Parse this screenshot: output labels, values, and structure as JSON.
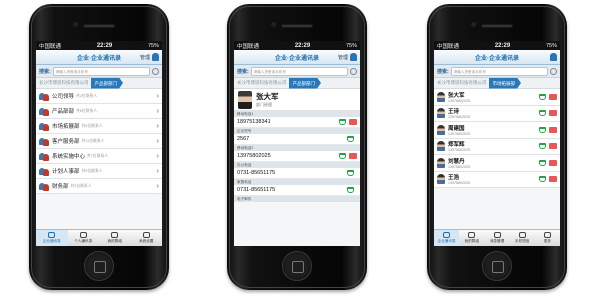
{
  "status": {
    "carrier": "中国联通",
    "time": "22:29",
    "battery": "75%"
  },
  "colors": {
    "accent": "#1b6fb0",
    "call": "#27a04a",
    "sms": "#e85656"
  },
  "app": {
    "title": "企业·企业通讯录",
    "user": "管理"
  },
  "search": {
    "label": "搜索:",
    "placeholder": "请输入拼音或手机号"
  },
  "screen1": {
    "crumbs": [
      "长沙市博思科技有限公司",
      "产品部部门"
    ],
    "departments": [
      {
        "name": "公司领导",
        "count": "共2位联系人",
        "icon": "group-icon"
      },
      {
        "name": "产品部部",
        "count": "共6位联系人",
        "icon": "group-icon"
      },
      {
        "name": "市场拓展部",
        "count": "共6位联系人",
        "icon": "group-icon"
      },
      {
        "name": "客户服务部",
        "count": "共11位联系人",
        "icon": "group-icon"
      },
      {
        "name": "系统实施中心",
        "count": "共7位联系人",
        "icon": "group-icon"
      },
      {
        "name": "计划人事部",
        "count": "共6位联系人",
        "icon": "group-icon"
      },
      {
        "name": "财务部",
        "count": "共3位联系人",
        "icon": "group-icon"
      }
    ]
  },
  "screen2": {
    "crumbs": [
      "长沙市博思科技有限公司",
      "产品部部门"
    ],
    "contact": {
      "name": "张大军",
      "dept": "部门经理"
    },
    "fields": [
      {
        "label": "移动电话1",
        "value": "18975138341",
        "call": true,
        "sms": true
      },
      {
        "label": "企业短号",
        "value": "2567",
        "call": true,
        "sms": false
      },
      {
        "label": "移动电话2",
        "value": "13975802025",
        "call": true,
        "sms": true
      },
      {
        "label": "办公电话",
        "value": "0731-85651175",
        "call": true,
        "sms": false
      },
      {
        "label": "家庭电话",
        "value": "0731-85651175",
        "call": true,
        "sms": false
      },
      {
        "label": "电子邮件",
        "value": "",
        "call": false,
        "sms": false
      }
    ]
  },
  "screen3": {
    "crumbs": [
      "长沙市博思科技有限公司",
      "市场拓展部"
    ],
    "contacts": [
      {
        "name": "张大军",
        "phone": "13975802025"
      },
      {
        "name": "王诗",
        "phone": "13975802025"
      },
      {
        "name": "周建国",
        "phone": "13975802025"
      },
      {
        "name": "郑军辉",
        "phone": "13975802025"
      },
      {
        "name": "刘慧丹",
        "phone": "13975802025"
      },
      {
        "name": "王浩",
        "phone": "13975802025"
      }
    ]
  },
  "tabs_screen1": [
    "企业通讯录",
    "个人通讯录",
    "我的群组",
    "系统设置"
  ],
  "tabs_screen3": [
    "企业通讯录",
    "我的群组",
    "消息管理",
    "手机短信",
    "更多"
  ]
}
